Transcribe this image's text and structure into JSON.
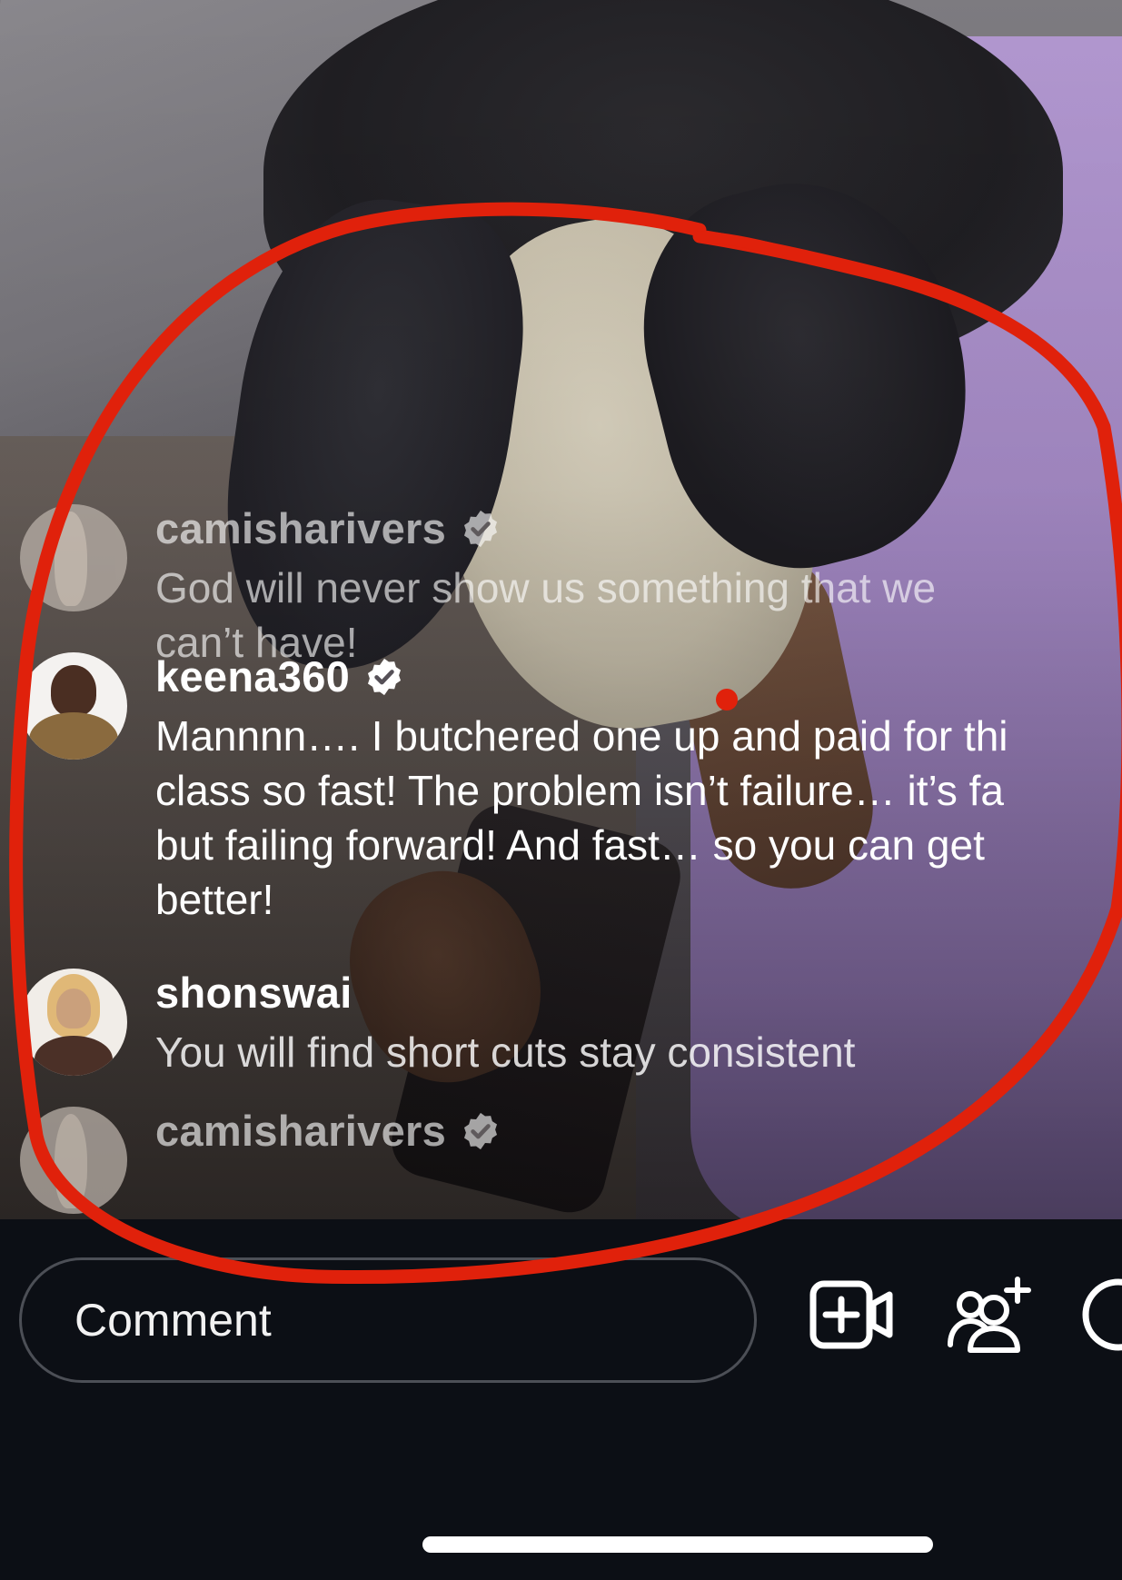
{
  "live": {
    "comments": [
      {
        "username": "camisharivers",
        "verified": true,
        "avatar_icon": "avatar-camisharivers",
        "message_lines": [
          "God will never show us something that we",
          "can’t have!"
        ]
      },
      {
        "username": "keena360",
        "verified": true,
        "avatar_icon": "avatar-keena360",
        "message_lines": [
          "Mannnn…. I butchered one up and paid for thi",
          "class so fast! The problem isn’t failure… it’s fa",
          "but failing forward! And fast… so you can get",
          "better!"
        ]
      },
      {
        "username": "shonswai",
        "verified": false,
        "avatar_icon": "avatar-shonswai",
        "message_lines": [
          "You will find short cuts stay consistent"
        ]
      },
      {
        "username": "camisharivers",
        "verified": true,
        "avatar_icon": "avatar-camisharivers",
        "message_lines": []
      }
    ]
  },
  "bottom_bar": {
    "comment_placeholder": "Comment",
    "icons": [
      "add-video-icon",
      "invite-people-icon",
      "more-icon"
    ]
  },
  "colors": {
    "annotation_red": "#e0210b",
    "bar_background": "#0c0f15",
    "input_border": "#4c4f56"
  }
}
